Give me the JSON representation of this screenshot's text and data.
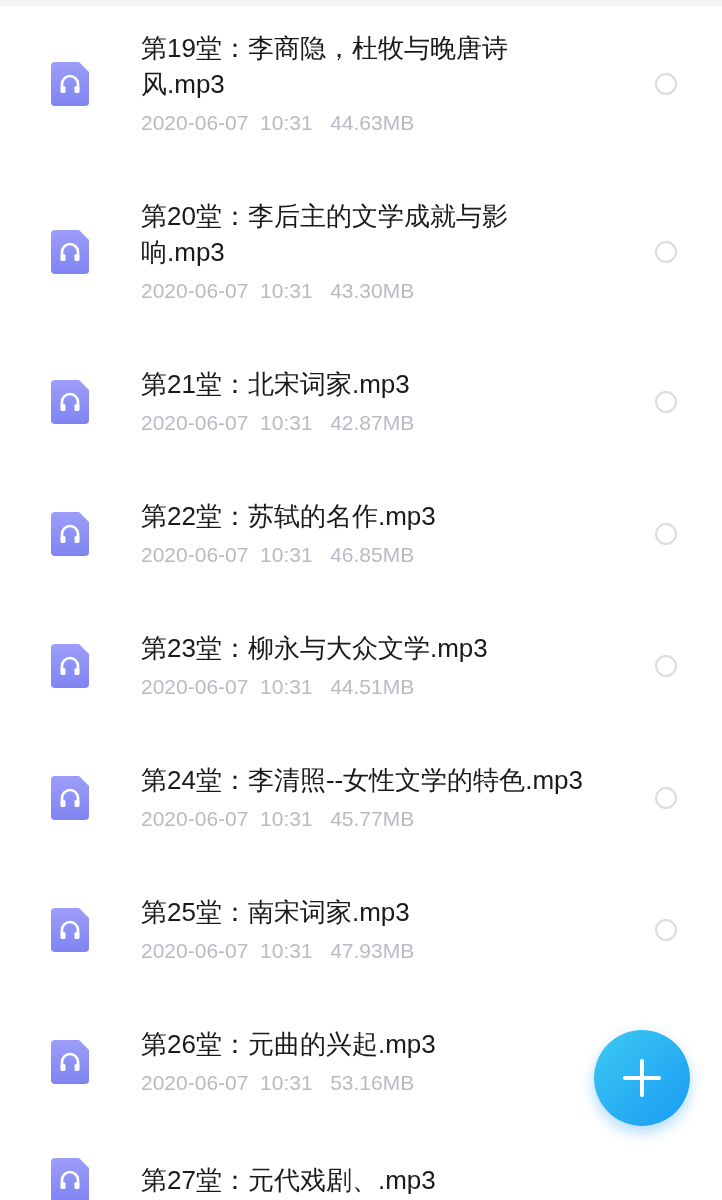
{
  "files": [
    {
      "name": "第19堂：李商隐，杜牧与晚唐诗风.mp3",
      "date": "2020-06-07",
      "time": "10:31",
      "size": "44.63MB",
      "selected": false
    },
    {
      "name": "第20堂：李后主的文学成就与影响.mp3",
      "date": "2020-06-07",
      "time": "10:31",
      "size": "43.30MB",
      "selected": false
    },
    {
      "name": "第21堂：北宋词家.mp3",
      "date": "2020-06-07",
      "time": "10:31",
      "size": "42.87MB",
      "selected": false
    },
    {
      "name": "第22堂：苏轼的名作.mp3",
      "date": "2020-06-07",
      "time": "10:31",
      "size": "46.85MB",
      "selected": false
    },
    {
      "name": "第23堂：柳永与大众文学.mp3",
      "date": "2020-06-07",
      "time": "10:31",
      "size": "44.51MB",
      "selected": false
    },
    {
      "name": "第24堂：李清照--女性文学的特色.mp3",
      "date": "2020-06-07",
      "time": "10:31",
      "size": "45.77MB",
      "selected": false
    },
    {
      "name": "第25堂：南宋词家.mp3",
      "date": "2020-06-07",
      "time": "10:31",
      "size": "47.93MB",
      "selected": false
    },
    {
      "name": "第26堂：元曲的兴起.mp3",
      "date": "2020-06-07",
      "time": "10:31",
      "size": "53.16MB"
    },
    {
      "name": "第27堂：元代戏剧、.mp3"
    }
  ]
}
